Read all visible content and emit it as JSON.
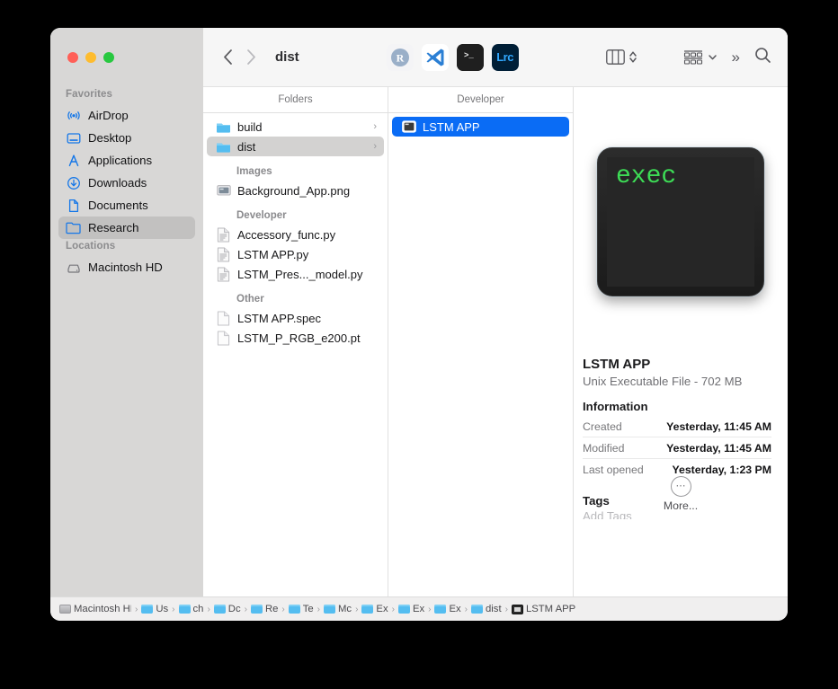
{
  "window": {
    "title": "dist",
    "traffic_lights": [
      "close",
      "minimize",
      "zoom"
    ]
  },
  "toolbar": {
    "back_label": "‹",
    "forward_label": "›",
    "apps": [
      {
        "name": "rstudio",
        "label": "R"
      },
      {
        "name": "vscode",
        "label": ""
      },
      {
        "name": "terminal",
        "label": ">_"
      },
      {
        "name": "lightroom-classic",
        "label": "Lrc"
      }
    ],
    "view_mode": "column-view",
    "group_by": "group-by",
    "overflow_label": "»",
    "search_label": "search"
  },
  "sidebar": {
    "sections": [
      {
        "title": "Favorites",
        "items": [
          {
            "label": "AirDrop",
            "icon": "airdrop-icon",
            "selected": false
          },
          {
            "label": "Desktop",
            "icon": "desktop-icon",
            "selected": false
          },
          {
            "label": "Applications",
            "icon": "applications-icon",
            "selected": false
          },
          {
            "label": "Downloads",
            "icon": "downloads-icon",
            "selected": false
          },
          {
            "label": "Documents",
            "icon": "documents-icon",
            "selected": false
          },
          {
            "label": "Research",
            "icon": "folder-icon",
            "selected": true
          }
        ]
      },
      {
        "title": "Locations",
        "items": [
          {
            "label": "Macintosh HD",
            "icon": "harddisk-icon",
            "selected": false
          }
        ]
      }
    ]
  },
  "columns": [
    {
      "header": "Folders",
      "groups": [
        {
          "label": "",
          "items": [
            {
              "label": "build",
              "icon": "folder-icon",
              "chevron": "›",
              "selected": false
            },
            {
              "label": "dist",
              "icon": "folder-icon",
              "chevron": "›",
              "selected": "gray"
            }
          ]
        },
        {
          "label": "Images",
          "items": [
            {
              "label": "Background_App.png",
              "icon": "image-file-icon",
              "chevron": "",
              "selected": false
            }
          ]
        },
        {
          "label": "Developer",
          "items": [
            {
              "label": "Accessory_func.py",
              "icon": "code-file-icon",
              "chevron": "",
              "selected": false
            },
            {
              "label": "LSTM APP.py",
              "icon": "code-file-icon",
              "chevron": "",
              "selected": false
            },
            {
              "label": "LSTM_Pres..._model.py",
              "icon": "code-file-icon",
              "chevron": "",
              "selected": false
            }
          ]
        },
        {
          "label": "Other",
          "items": [
            {
              "label": "LSTM APP.spec",
              "icon": "blank-file-icon",
              "chevron": "",
              "selected": false
            },
            {
              "label": "LSTM_P_RGB_e200.pt",
              "icon": "blank-file-icon",
              "chevron": "",
              "selected": false
            }
          ]
        }
      ]
    },
    {
      "header": "Developer",
      "groups": [
        {
          "label": "",
          "items": [
            {
              "label": "LSTM APP",
              "icon": "exec-file-icon",
              "chevron": "",
              "selected": "blue"
            }
          ]
        }
      ]
    }
  ],
  "preview": {
    "icon_text": "exec",
    "file_name": "LSTM APP",
    "file_kind": "Unix Executable File - 702 MB",
    "information_heading": "Information",
    "information_rows": [
      {
        "key": "Created",
        "value": "Yesterday, 11:45 AM"
      },
      {
        "key": "Modified",
        "value": "Yesterday, 11:45 AM"
      },
      {
        "key": "Last opened",
        "value": "Yesterday, 1:23 PM"
      }
    ],
    "tags_heading": "Tags",
    "add_tags_placeholder": "Add Tags",
    "more_label": "More...",
    "more_icon": "⋯"
  },
  "pathbar": {
    "crumbs": [
      {
        "label": "Macintosh HD",
        "icon": "harddisk-icon"
      },
      {
        "label": "Us",
        "icon": "folder-icon"
      },
      {
        "label": "ch",
        "icon": "folder-icon"
      },
      {
        "label": "Dc",
        "icon": "folder-icon"
      },
      {
        "label": "Re",
        "icon": "folder-icon"
      },
      {
        "label": "Te",
        "icon": "folder-icon"
      },
      {
        "label": "Mc",
        "icon": "folder-icon"
      },
      {
        "label": "Ex",
        "icon": "folder-icon"
      },
      {
        "label": "Ex",
        "icon": "folder-icon"
      },
      {
        "label": "Ex",
        "icon": "folder-icon"
      },
      {
        "label": "dist",
        "icon": "folder-icon"
      },
      {
        "label": "LSTM APP",
        "icon": "exec-file-icon"
      }
    ],
    "separator": "›"
  },
  "colors": {
    "accent_blue": "#0a6cf5",
    "folder_blue": "#54bdf0",
    "sidebar_bg": "#d8d7d6",
    "exec_green": "#3ddc56"
  }
}
